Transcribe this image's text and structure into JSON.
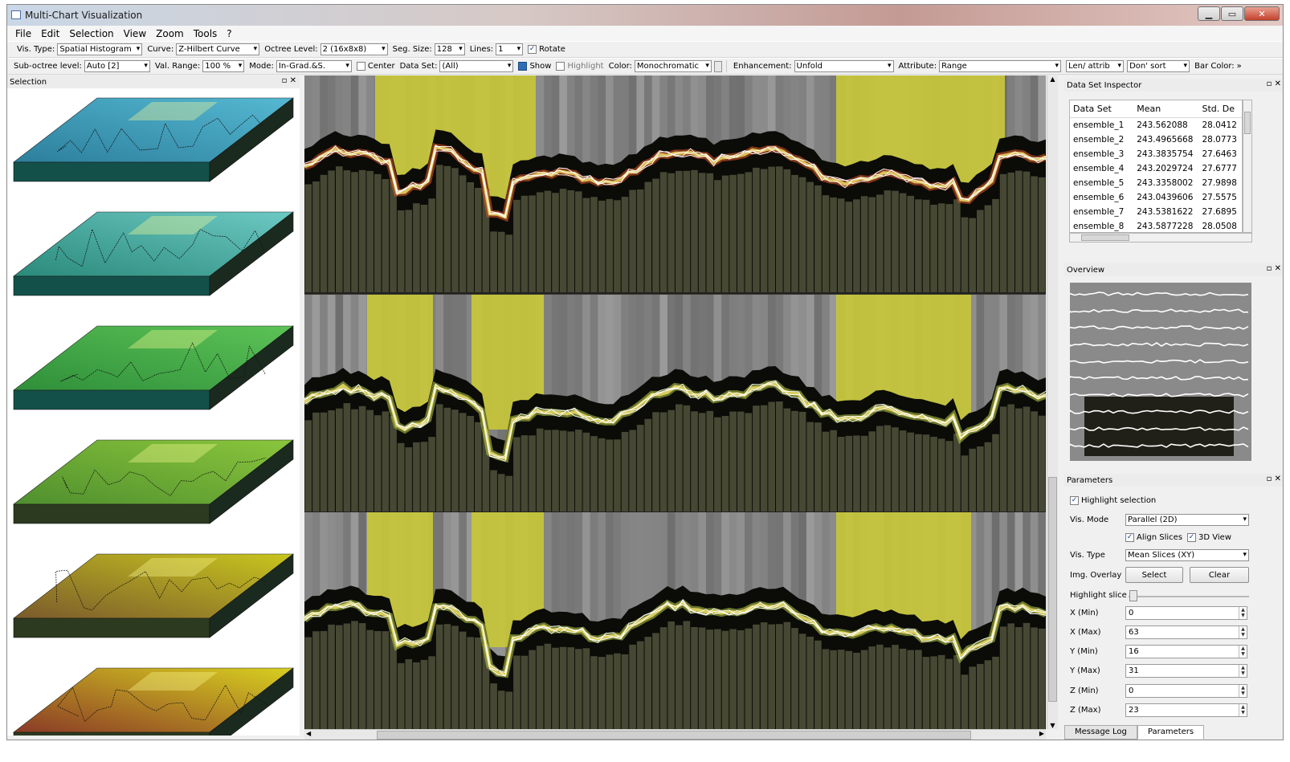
{
  "window": {
    "title": "Multi-Chart Visualization",
    "minimize": "▁",
    "maximize": "▭",
    "close": "✕"
  },
  "menu": [
    "File",
    "Edit",
    "Selection",
    "View",
    "Zoom",
    "Tools",
    "?"
  ],
  "toolbar1": {
    "vis_type_label": "Vis. Type:",
    "vis_type": "Spatial Histogram",
    "curve_label": "Curve:",
    "curve": "Z-Hilbert Curve",
    "octree_label": "Octree Level:",
    "octree": "2 (16x8x8)",
    "seg_label": "Seg. Size:",
    "seg": "128",
    "lines_label": "Lines:",
    "lines": "1",
    "rotate_label": "Rotate"
  },
  "toolbar2": {
    "sub_label": "Sub-octree level:",
    "sub": "Auto [2]",
    "range_label": "Val. Range:",
    "range": "100 %",
    "mode_label": "Mode:",
    "mode": "In-Grad.&S.",
    "center_label": "Center",
    "dataset_label": "Data Set:",
    "dataset": "(All)",
    "show_label": "Show",
    "highlight_label": "Highlight",
    "color_label": "Color:",
    "color": "Monochromatic",
    "enh_label": "Enhancement:",
    "enh": "Unfold",
    "attr_label": "Attribute:",
    "attr": "Range",
    "len": "Len/ attrib",
    "sort": "Don' sort",
    "barcolor_label": "Bar Color:",
    "more": "»"
  },
  "selection_panel": {
    "title": "Selection",
    "btns": "▫ ✕"
  },
  "inspector": {
    "title": "Data Set Inspector",
    "btns": "▫ ✕",
    "columns": [
      "Data Set",
      "Mean",
      "Std. De"
    ],
    "rows": [
      [
        "ensemble_1",
        "243.562088",
        "28.0412"
      ],
      [
        "ensemble_2",
        "243.4965668",
        "28.0773"
      ],
      [
        "ensemble_3",
        "243.3835754",
        "27.6463"
      ],
      [
        "ensemble_4",
        "243.2029724",
        "27.6777"
      ],
      [
        "ensemble_5",
        "243.3358002",
        "27.9898"
      ],
      [
        "ensemble_6",
        "243.0439606",
        "27.5575"
      ],
      [
        "ensemble_7",
        "243.5381622",
        "27.6895"
      ],
      [
        "ensemble_8",
        "243.5877228",
        "28.0508"
      ]
    ]
  },
  "overview": {
    "title": "Overview",
    "btns": "▫ ✕"
  },
  "parameters": {
    "title": "Parameters",
    "btns": "▫ ✕",
    "highlight_selection": "Highlight selection",
    "vis_mode_label": "Vis. Mode",
    "vis_mode": "Parallel (2D)",
    "align_slices": "Align Slices",
    "view3d": "3D View",
    "vis_type_label": "Vis. Type",
    "vis_type": "Mean Slices (XY)",
    "img_overlay_label": "Img. Overlay",
    "select_btn": "Select",
    "clear_btn": "Clear",
    "highlight_slice_label": "Highlight slice",
    "fields": [
      {
        "label": "X (Min)",
        "value": "0"
      },
      {
        "label": "X (Max)",
        "value": "63"
      },
      {
        "label": "Y (Min)",
        "value": "16"
      },
      {
        "label": "Y (Max)",
        "value": "31"
      },
      {
        "label": "Z (Min)",
        "value": "0"
      },
      {
        "label": "Z (Max)",
        "value": "23"
      }
    ]
  },
  "tabs": [
    "Message Log",
    "Parameters"
  ],
  "colors": {
    "highlight_band": "#c7c73a",
    "bar": "#4d4f3a",
    "line": "#ffffff"
  }
}
